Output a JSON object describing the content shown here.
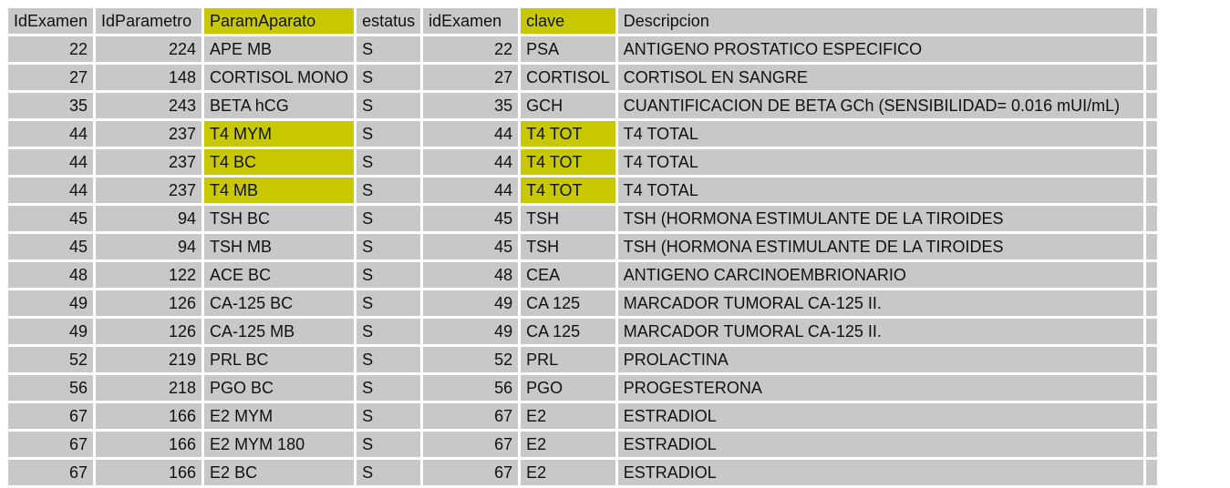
{
  "accent_highlight": "#c8c800",
  "grid_bg": "#c8c8c8",
  "headers": [
    "IdExamen",
    "IdParametro",
    "ParamAparato",
    "estatus",
    "idExamen",
    "clave",
    "Descripcion"
  ],
  "highlighted_columns": [
    "ParamAparato",
    "clave"
  ],
  "rows": [
    {
      "idexamen": "22",
      "idparametro": "224",
      "paramaparato": "APE MB",
      "estatus": "S",
      "idexamen2": "22",
      "clave": "PSA",
      "descripcion": "ANTIGENO PROSTATICO ESPECIFICO",
      "hl": false
    },
    {
      "idexamen": "27",
      "idparametro": "148",
      "paramaparato": "CORTISOL MONO",
      "estatus": "S",
      "idexamen2": "27",
      "clave": "CORTISOL",
      "descripcion": "CORTISOL EN SANGRE",
      "hl": false
    },
    {
      "idexamen": "35",
      "idparametro": "243",
      "paramaparato": "BETA hCG",
      "estatus": "S",
      "idexamen2": "35",
      "clave": "GCH",
      "descripcion": "CUANTIFICACION DE BETA GCh  (SENSIBILIDAD= 0.016 mUI/mL)",
      "hl": false
    },
    {
      "idexamen": "44",
      "idparametro": "237",
      "paramaparato": "T4  MYM",
      "estatus": "S",
      "idexamen2": "44",
      "clave": "T4 TOT",
      "descripcion": "T4 TOTAL",
      "hl": true
    },
    {
      "idexamen": "44",
      "idparametro": "237",
      "paramaparato": "T4 BC",
      "estatus": "S",
      "idexamen2": "44",
      "clave": "T4 TOT",
      "descripcion": "T4 TOTAL",
      "hl": true
    },
    {
      "idexamen": "44",
      "idparametro": "237",
      "paramaparato": "T4 MB",
      "estatus": "S",
      "idexamen2": "44",
      "clave": "T4 TOT",
      "descripcion": "T4 TOTAL",
      "hl": true
    },
    {
      "idexamen": "45",
      "idparametro": "94",
      "paramaparato": "TSH BC",
      "estatus": "S",
      "idexamen2": "45",
      "clave": "TSH",
      "descripcion": "TSH (HORMONA ESTIMULANTE DE LA TIROIDES",
      "hl": false
    },
    {
      "idexamen": "45",
      "idparametro": "94",
      "paramaparato": "TSH MB",
      "estatus": "S",
      "idexamen2": "45",
      "clave": "TSH",
      "descripcion": "TSH (HORMONA ESTIMULANTE DE LA TIROIDES",
      "hl": false
    },
    {
      "idexamen": "48",
      "idparametro": "122",
      "paramaparato": "ACE BC",
      "estatus": "S",
      "idexamen2": "48",
      "clave": "CEA",
      "descripcion": "ANTIGENO CARCINOEMBRIONARIO",
      "hl": false
    },
    {
      "idexamen": "49",
      "idparametro": "126",
      "paramaparato": "CA-125 BC",
      "estatus": "S",
      "idexamen2": "49",
      "clave": "CA 125",
      "descripcion": "MARCADOR TUMORAL CA-125 II.",
      "hl": false
    },
    {
      "idexamen": "49",
      "idparametro": "126",
      "paramaparato": "CA-125 MB",
      "estatus": "S",
      "idexamen2": "49",
      "clave": "CA 125",
      "descripcion": "MARCADOR TUMORAL CA-125 II.",
      "hl": false
    },
    {
      "idexamen": "52",
      "idparametro": "219",
      "paramaparato": "PRL BC",
      "estatus": "S",
      "idexamen2": "52",
      "clave": "PRL",
      "descripcion": "PROLACTINA",
      "hl": false
    },
    {
      "idexamen": "56",
      "idparametro": "218",
      "paramaparato": "PGO BC",
      "estatus": "S",
      "idexamen2": "56",
      "clave": "PGO",
      "descripcion": "PROGESTERONA",
      "hl": false
    },
    {
      "idexamen": "67",
      "idparametro": "166",
      "paramaparato": "E2  MYM",
      "estatus": "S",
      "idexamen2": "67",
      "clave": "E2",
      "descripcion": "ESTRADIOL",
      "hl": false
    },
    {
      "idexamen": "67",
      "idparametro": "166",
      "paramaparato": "E2  MYM 180",
      "estatus": "S",
      "idexamen2": "67",
      "clave": "E2",
      "descripcion": "ESTRADIOL",
      "hl": false
    },
    {
      "idexamen": "67",
      "idparametro": "166",
      "paramaparato": "E2 BC",
      "estatus": "S",
      "idexamen2": "67",
      "clave": "E2",
      "descripcion": "ESTRADIOL",
      "hl": false
    }
  ]
}
